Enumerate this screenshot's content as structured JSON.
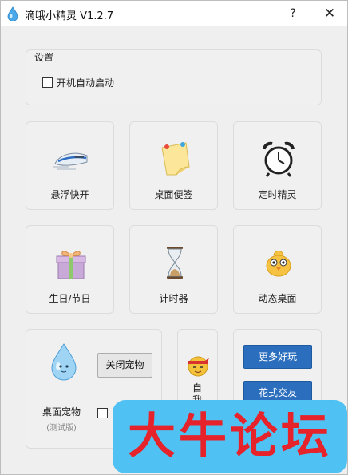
{
  "window": {
    "title": "滴哦小精灵 V1.2.7",
    "help_label": "?",
    "close_label": "✕",
    "icon": "water-drop-icon"
  },
  "settings": {
    "group_title": "设置",
    "autostart_label": "开机自动启动",
    "autostart_checked": false
  },
  "tiles": [
    {
      "label": "悬浮快开",
      "icon": "bullet-train-icon"
    },
    {
      "label": "桌面便签",
      "icon": "sticky-note-icon"
    },
    {
      "label": "定时精灵",
      "icon": "alarm-clock-icon"
    },
    {
      "label": "生日/节日",
      "icon": "gift-box-icon"
    },
    {
      "label": "计时器",
      "icon": "hourglass-icon"
    },
    {
      "label": "动态桌面",
      "icon": "chick-icon"
    }
  ],
  "pet": {
    "close_button_label": "关闭宠物",
    "label": "桌面宠物",
    "sublabel": "(测试版)",
    "checked": false,
    "icon": "water-drop-pet-icon"
  },
  "self_panel": {
    "label": "自我",
    "icon": "ninja-face-icon"
  },
  "more": {
    "more_fun_label": "更多好玩",
    "make_friends_label": "花式交友"
  },
  "watermark": {
    "text": "大牛论坛"
  },
  "colors": {
    "button_blue": "#2a6ebd",
    "watermark_bg": "#4fc1f2",
    "watermark_text": "#e6232b"
  }
}
